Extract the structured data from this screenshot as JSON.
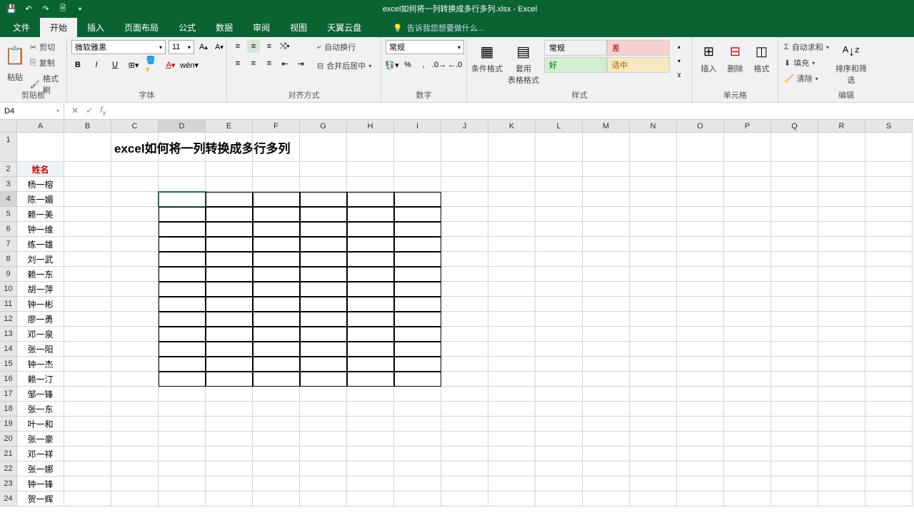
{
  "title": "excel如何将一列转换成多行多列.xlsx - Excel",
  "tabs": {
    "file": "文件",
    "home": "开始",
    "insert": "插入",
    "layout": "页面布局",
    "formula": "公式",
    "data": "数据",
    "review": "审阅",
    "view": "视图",
    "cloud": "天翼云盘",
    "tellme": "告诉我您想要做什么..."
  },
  "ribbon": {
    "clipboard": {
      "paste": "粘贴",
      "cut": "剪切",
      "copy": "复制",
      "brush": "格式刷",
      "label": "剪贴板"
    },
    "font": {
      "name": "微软雅黑",
      "size": "11",
      "label": "字体"
    },
    "align": {
      "wrap": "自动换行",
      "merge": "合并后居中",
      "label": "对齐方式"
    },
    "number": {
      "format": "常规",
      "label": "数字"
    },
    "styles": {
      "condfmt": "条件格式",
      "tablefmt": "套用\n表格格式",
      "normal": "常规",
      "bad": "差",
      "good": "好",
      "neutral": "适中",
      "label": "样式"
    },
    "cells": {
      "insert": "插入",
      "delete": "删除",
      "format": "格式",
      "label": "单元格"
    },
    "editing": {
      "sum": "自动求和",
      "fill": "填充",
      "clear": "清除",
      "sort": "排序和筛选",
      "label": "编辑"
    }
  },
  "namebox": "D4",
  "cols": [
    "A",
    "B",
    "C",
    "D",
    "E",
    "F",
    "G",
    "H",
    "I",
    "J",
    "K",
    "L",
    "M",
    "N",
    "O",
    "P",
    "Q",
    "R",
    "S"
  ],
  "sheet_title": "excel如何将一列转换成多行多列",
  "col_a_header": "姓名",
  "col_a": [
    "杨一榕",
    "陈一媚",
    "赖一美",
    "钟一维",
    "练一雄",
    "刘一武",
    "赖一东",
    "胡一萍",
    "钟一彬",
    "廖一勇",
    "邓一泉",
    "张一阳",
    "钟一杰",
    "赖一汀",
    "邹一锋",
    "张一东",
    "叶一和",
    "张一豪",
    "邓一祥",
    "张一娜",
    "钟一锋",
    "贺一辉"
  ],
  "selected_cell": {
    "row": 4,
    "col": "D"
  },
  "bordered_range": {
    "row_start": 4,
    "row_end": 16,
    "col_start": "D",
    "col_end": "I"
  }
}
